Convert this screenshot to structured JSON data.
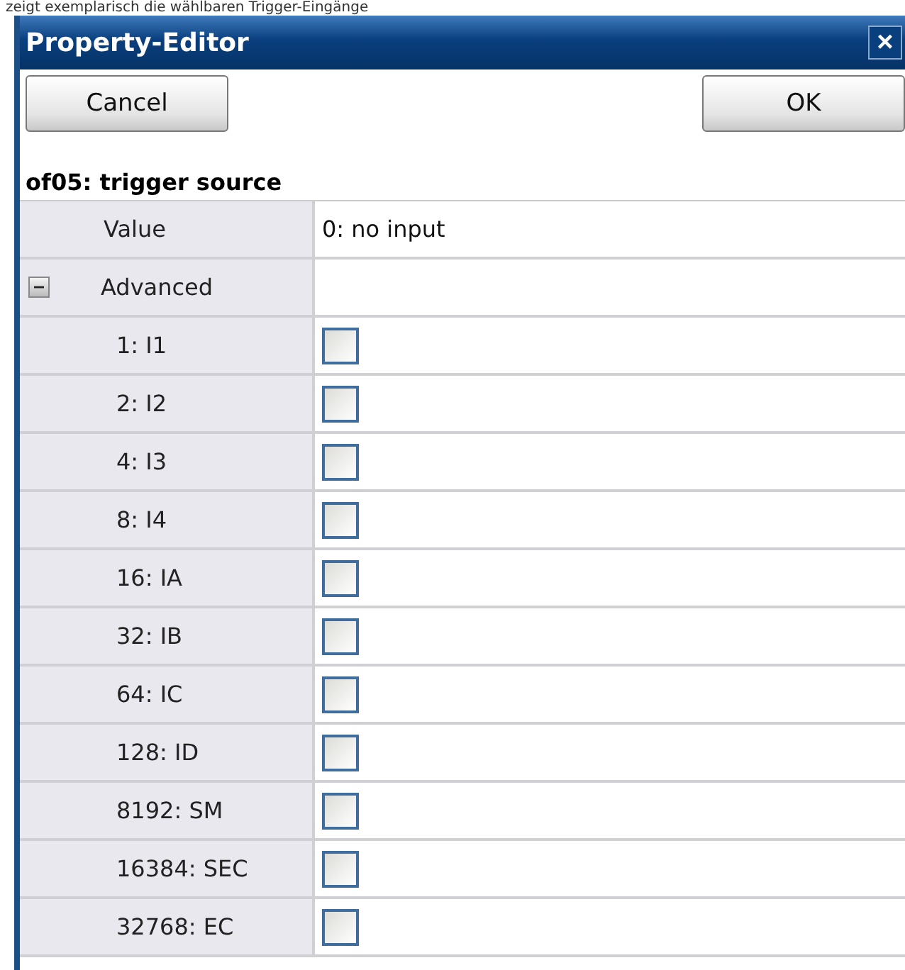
{
  "caption": "zeigt exemplarisch die wählbaren Trigger-Eingänge",
  "window": {
    "title": "Property-Editor",
    "close": "×"
  },
  "buttons": [
    {
      "label": "Cancel"
    },
    {
      "label": "OK"
    }
  ],
  "property": {
    "heading": "of05: trigger source",
    "value_label": "Value",
    "value": "0: no input",
    "group": {
      "label": "Advanced",
      "expanded": true,
      "items": [
        {
          "label": "1: I1",
          "checked": false
        },
        {
          "label": "2: I2",
          "checked": false
        },
        {
          "label": "4: I3",
          "checked": false
        },
        {
          "label": "8: I4",
          "checked": false
        },
        {
          "label": "16: IA",
          "checked": false
        },
        {
          "label": "32: IB",
          "checked": false
        },
        {
          "label": "64: IC",
          "checked": false
        },
        {
          "label": "128: ID",
          "checked": false
        },
        {
          "label": "8192: SM",
          "checked": false
        },
        {
          "label": "16384: SEC",
          "checked": false
        },
        {
          "label": "32768: EC",
          "checked": false
        }
      ]
    }
  }
}
